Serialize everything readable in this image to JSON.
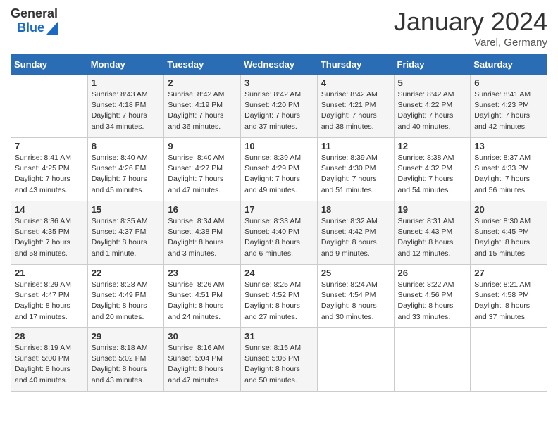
{
  "logo": {
    "general": "General",
    "blue": "Blue"
  },
  "title": "January 2024",
  "location": "Varel, Germany",
  "days_of_week": [
    "Sunday",
    "Monday",
    "Tuesday",
    "Wednesday",
    "Thursday",
    "Friday",
    "Saturday"
  ],
  "weeks": [
    [
      {
        "day": null
      },
      {
        "day": 1,
        "sunrise": "Sunrise: 8:43 AM",
        "sunset": "Sunset: 4:18 PM",
        "daylight": "Daylight: 7 hours and 34 minutes."
      },
      {
        "day": 2,
        "sunrise": "Sunrise: 8:42 AM",
        "sunset": "Sunset: 4:19 PM",
        "daylight": "Daylight: 7 hours and 36 minutes."
      },
      {
        "day": 3,
        "sunrise": "Sunrise: 8:42 AM",
        "sunset": "Sunset: 4:20 PM",
        "daylight": "Daylight: 7 hours and 37 minutes."
      },
      {
        "day": 4,
        "sunrise": "Sunrise: 8:42 AM",
        "sunset": "Sunset: 4:21 PM",
        "daylight": "Daylight: 7 hours and 38 minutes."
      },
      {
        "day": 5,
        "sunrise": "Sunrise: 8:42 AM",
        "sunset": "Sunset: 4:22 PM",
        "daylight": "Daylight: 7 hours and 40 minutes."
      },
      {
        "day": 6,
        "sunrise": "Sunrise: 8:41 AM",
        "sunset": "Sunset: 4:23 PM",
        "daylight": "Daylight: 7 hours and 42 minutes."
      }
    ],
    [
      {
        "day": 7,
        "sunrise": "Sunrise: 8:41 AM",
        "sunset": "Sunset: 4:25 PM",
        "daylight": "Daylight: 7 hours and 43 minutes."
      },
      {
        "day": 8,
        "sunrise": "Sunrise: 8:40 AM",
        "sunset": "Sunset: 4:26 PM",
        "daylight": "Daylight: 7 hours and 45 minutes."
      },
      {
        "day": 9,
        "sunrise": "Sunrise: 8:40 AM",
        "sunset": "Sunset: 4:27 PM",
        "daylight": "Daylight: 7 hours and 47 minutes."
      },
      {
        "day": 10,
        "sunrise": "Sunrise: 8:39 AM",
        "sunset": "Sunset: 4:29 PM",
        "daylight": "Daylight: 7 hours and 49 minutes."
      },
      {
        "day": 11,
        "sunrise": "Sunrise: 8:39 AM",
        "sunset": "Sunset: 4:30 PM",
        "daylight": "Daylight: 7 hours and 51 minutes."
      },
      {
        "day": 12,
        "sunrise": "Sunrise: 8:38 AM",
        "sunset": "Sunset: 4:32 PM",
        "daylight": "Daylight: 7 hours and 54 minutes."
      },
      {
        "day": 13,
        "sunrise": "Sunrise: 8:37 AM",
        "sunset": "Sunset: 4:33 PM",
        "daylight": "Daylight: 7 hours and 56 minutes."
      }
    ],
    [
      {
        "day": 14,
        "sunrise": "Sunrise: 8:36 AM",
        "sunset": "Sunset: 4:35 PM",
        "daylight": "Daylight: 7 hours and 58 minutes."
      },
      {
        "day": 15,
        "sunrise": "Sunrise: 8:35 AM",
        "sunset": "Sunset: 4:37 PM",
        "daylight": "Daylight: 8 hours and 1 minute."
      },
      {
        "day": 16,
        "sunrise": "Sunrise: 8:34 AM",
        "sunset": "Sunset: 4:38 PM",
        "daylight": "Daylight: 8 hours and 3 minutes."
      },
      {
        "day": 17,
        "sunrise": "Sunrise: 8:33 AM",
        "sunset": "Sunset: 4:40 PM",
        "daylight": "Daylight: 8 hours and 6 minutes."
      },
      {
        "day": 18,
        "sunrise": "Sunrise: 8:32 AM",
        "sunset": "Sunset: 4:42 PM",
        "daylight": "Daylight: 8 hours and 9 minutes."
      },
      {
        "day": 19,
        "sunrise": "Sunrise: 8:31 AM",
        "sunset": "Sunset: 4:43 PM",
        "daylight": "Daylight: 8 hours and 12 minutes."
      },
      {
        "day": 20,
        "sunrise": "Sunrise: 8:30 AM",
        "sunset": "Sunset: 4:45 PM",
        "daylight": "Daylight: 8 hours and 15 minutes."
      }
    ],
    [
      {
        "day": 21,
        "sunrise": "Sunrise: 8:29 AM",
        "sunset": "Sunset: 4:47 PM",
        "daylight": "Daylight: 8 hours and 17 minutes."
      },
      {
        "day": 22,
        "sunrise": "Sunrise: 8:28 AM",
        "sunset": "Sunset: 4:49 PM",
        "daylight": "Daylight: 8 hours and 20 minutes."
      },
      {
        "day": 23,
        "sunrise": "Sunrise: 8:26 AM",
        "sunset": "Sunset: 4:51 PM",
        "daylight": "Daylight: 8 hours and 24 minutes."
      },
      {
        "day": 24,
        "sunrise": "Sunrise: 8:25 AM",
        "sunset": "Sunset: 4:52 PM",
        "daylight": "Daylight: 8 hours and 27 minutes."
      },
      {
        "day": 25,
        "sunrise": "Sunrise: 8:24 AM",
        "sunset": "Sunset: 4:54 PM",
        "daylight": "Daylight: 8 hours and 30 minutes."
      },
      {
        "day": 26,
        "sunrise": "Sunrise: 8:22 AM",
        "sunset": "Sunset: 4:56 PM",
        "daylight": "Daylight: 8 hours and 33 minutes."
      },
      {
        "day": 27,
        "sunrise": "Sunrise: 8:21 AM",
        "sunset": "Sunset: 4:58 PM",
        "daylight": "Daylight: 8 hours and 37 minutes."
      }
    ],
    [
      {
        "day": 28,
        "sunrise": "Sunrise: 8:19 AM",
        "sunset": "Sunset: 5:00 PM",
        "daylight": "Daylight: 8 hours and 40 minutes."
      },
      {
        "day": 29,
        "sunrise": "Sunrise: 8:18 AM",
        "sunset": "Sunset: 5:02 PM",
        "daylight": "Daylight: 8 hours and 43 minutes."
      },
      {
        "day": 30,
        "sunrise": "Sunrise: 8:16 AM",
        "sunset": "Sunset: 5:04 PM",
        "daylight": "Daylight: 8 hours and 47 minutes."
      },
      {
        "day": 31,
        "sunrise": "Sunrise: 8:15 AM",
        "sunset": "Sunset: 5:06 PM",
        "daylight": "Daylight: 8 hours and 50 minutes."
      },
      {
        "day": null
      },
      {
        "day": null
      },
      {
        "day": null
      }
    ]
  ]
}
